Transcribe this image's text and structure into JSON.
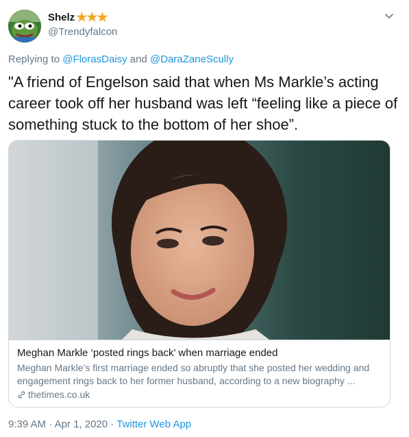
{
  "user": {
    "display_name": "Shelz",
    "badge": "★★★",
    "handle": "@Trendyfalcon",
    "avatar_icon": "pepe-frog-avatar"
  },
  "reply": {
    "prefix": "Replying to ",
    "mention1": "@FlorasDaisy",
    "and": " and ",
    "mention2": "@DaraZaneScully"
  },
  "tweet_text": "\"A friend of Engelson said that when Ms Markle’s acting career took off her husband was left “feeling like a piece of something stuck to the bottom of her shoe”.",
  "card": {
    "image_icon": "article-photo",
    "title": "Meghan Markle ‘posted rings back’ when marriage ended",
    "description": "Meghan Markle’s first marriage ended so abruptly that she posted her wedding and engagement rings back to her former husband, according to a new biography ...",
    "domain": "thetimes.co.uk"
  },
  "meta": {
    "time": "9:39 AM",
    "sep1": " · ",
    "date": "Apr 1, 2020",
    "sep2": " · ",
    "app": "Twitter Web App"
  },
  "colors": {
    "link": "#1b95e0",
    "secondary": "#657786",
    "star": "#f5a623",
    "border": "#ccd6dd"
  }
}
